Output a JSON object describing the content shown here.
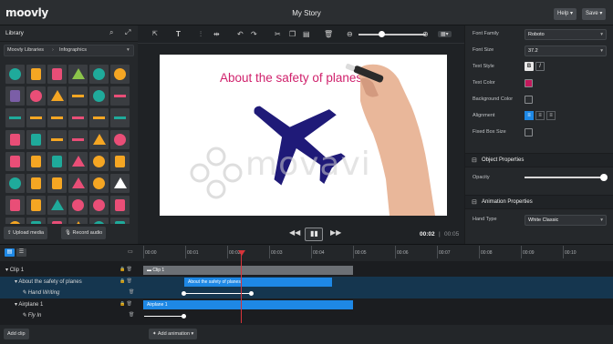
{
  "app": {
    "logo": "moovly",
    "project_title": "My Story"
  },
  "header": {
    "help_label": "Help ▾",
    "save_label": "Save ▾"
  },
  "library": {
    "title": "Library",
    "breadcrumb_root": "Moovly Libraries",
    "breadcrumb_sep": "›",
    "breadcrumb_current": "Infographics",
    "upload_label": "Upload media",
    "record_label": "Record audio"
  },
  "canvas": {
    "headline": "About the safety of planes",
    "watermark": "movavi",
    "time_current": "00:02",
    "time_total": "00:05",
    "colors": {
      "headline": "#d0216c",
      "plane": "#1f1a78"
    }
  },
  "properties": {
    "font_family_label": "Font Family",
    "font_family_value": "Roboto",
    "font_size_label": "Font Size",
    "font_size_value": "37.2",
    "text_style_label": "Text Style",
    "style_bold": "B",
    "style_italic": "I",
    "text_color_label": "Text Color",
    "bg_color_label": "Background Color",
    "alignment_label": "Alignment",
    "fixed_box_label": "Fixed Box Size",
    "object_section": "Object Properties",
    "opacity_label": "Opacity",
    "opacity_value": 1.0,
    "animation_section": "Animation Properties",
    "hand_type_label": "Hand Type",
    "hand_type_value": "White Classic",
    "colors": {
      "text_color": "#c2185b",
      "accent": "#1e88e5"
    }
  },
  "timeline": {
    "ruler": [
      "00:00",
      "00:01",
      "00:02",
      "00:03",
      "00:04",
      "00:05",
      "00:06",
      "00:07",
      "00:08",
      "00:09",
      "00:10"
    ],
    "tracks": [
      {
        "name": "Clip 1",
        "bar_label": "Clip 1"
      },
      {
        "name": "About the safety of planes",
        "bar_label": "About the safety of planes"
      },
      {
        "name": "Hand Writing"
      },
      {
        "name": "Airplane 1",
        "bar_label": "Airplane 1"
      },
      {
        "name": "Fly In"
      }
    ],
    "add_clip_label": "Add clip",
    "add_animation_label": "Add animation ▾",
    "colors": {
      "clip_bar": "#6c7075",
      "object_bar": "#1e88e5",
      "selected_row": "#15364f",
      "playhead": "#d8343a"
    }
  }
}
